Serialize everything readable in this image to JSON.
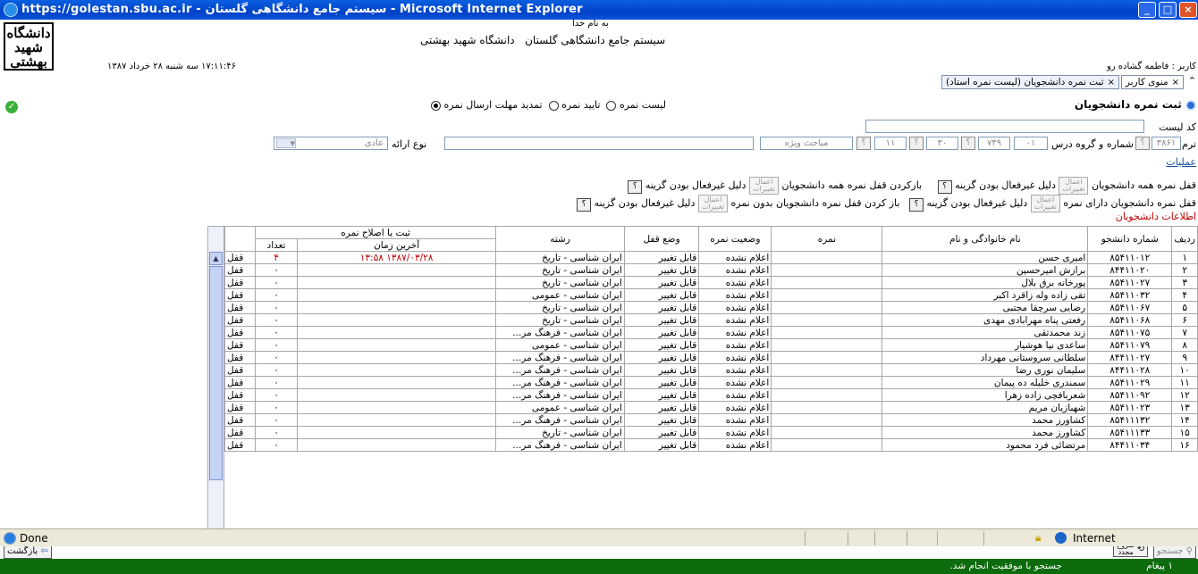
{
  "window": {
    "title": "https://golestan.sbu.ac.ir - سیستم جامع دانشگاهی گلستان - Microsoft Internet Explorer",
    "minimize": "_",
    "maximize": "□",
    "close": "×"
  },
  "header": {
    "basmala": "به نام خدا",
    "system_name": "سیستم جامع دانشگاهی گلستان",
    "university": "دانشگاه شهید بهشتی",
    "datetime": "۱۷:۱۱:۴۶ سه شنبه ۲۸ خرداد ۱۳۸۷",
    "user": "کاربر : فاطمه گشاده رو",
    "logo_lines": [
      "دانشگاه",
      "شهید",
      "بهشتی"
    ]
  },
  "tabs": [
    {
      "label": "منوی کاربر"
    },
    {
      "label": "ثبت نمره دانشجویان (لیست نمره استاد)"
    }
  ],
  "form": {
    "title": "ثبت نمره دانشجویان",
    "list_code_label": "کد لیست",
    "term_label": "ترم",
    "term_value": "۳۸۶۱",
    "course_label": "شماره و گروه درس",
    "course_values": [
      "۰۱",
      "۷۴۹",
      "۳۰",
      "۱۱"
    ],
    "special_topics_placeholder": "مباحث ویژه",
    "presentation_label": "نوع ارائه",
    "presentation_value": "عادی",
    "operations_link": "عملیات",
    "radios": [
      {
        "label": "لیست نمره",
        "selected": false
      },
      {
        "label": "تایید نمره",
        "selected": false
      },
      {
        "label": "تمدید مهلت ارسال نمره",
        "selected": true
      }
    ]
  },
  "actions": {
    "row1": [
      {
        "label": "قفل نمره همه دانشجویان",
        "reason": "دلیل غیرفعال بودن گزینه"
      },
      {
        "label": "بازکردن قفل نمره همه دانشجویان",
        "reason": "دلیل غیرفعال بودن گزینه"
      }
    ],
    "row2": [
      {
        "label": "قفل نمره دانشجویان دارای نمره",
        "reason": "دلیل غیرفعال بودن گزینه"
      },
      {
        "label": "باز کردن قفل نمره دانشجویان بدون نمره",
        "reason": "دلیل غیرفعال بودن گزینه"
      }
    ],
    "apply_label_top": "اعمال",
    "apply_label_bottom": "تغییرات",
    "help": "؟"
  },
  "students_section": "اطلاعات دانشجویان",
  "table": {
    "headers": {
      "row": "ردیف",
      "student_no": "شماره دانشجو",
      "name": "نام خانوادگی و نام",
      "grade": "نمره",
      "grade_status": "وضعیت نمره",
      "lock_status": "وضع قفل",
      "field": "رشته",
      "record_group": "ثبت یا اصلاح نمره",
      "last_time": "آخرین زمان",
      "count": "تعداد"
    },
    "rows": [
      {
        "n": "۱",
        "id": "۸۵۴۱۱۰۱۲",
        "name": "امیری حسن",
        "grade": "",
        "gs": "اعلام نشده",
        "ls": "قابل تغییر",
        "field": "ایران شناسی - تاریخ",
        "time": "۱۳۸۷/۰۳/۲۸ ۱۳:۵۸",
        "count": "۴",
        "lock": "قفل"
      },
      {
        "n": "۲",
        "id": "۸۴۴۱۱۰۲۰",
        "name": "برازش امیرحسین",
        "grade": "",
        "gs": "اعلام نشده",
        "ls": "قابل تغییر",
        "field": "ایران شناسی - تاریخ",
        "time": "",
        "count": "۰",
        "lock": "قفل"
      },
      {
        "n": "۳",
        "id": "۸۵۴۱۱۰۲۷",
        "name": "پورخانه برق بلال",
        "grade": "",
        "gs": "اعلام نشده",
        "ls": "قابل تغییر",
        "field": "ایران شناسی - تاریخ",
        "time": "",
        "count": "۰",
        "lock": "قفل"
      },
      {
        "n": "۴",
        "id": "۸۵۴۱۱۰۳۲",
        "name": "تقی زاده وله زاقرد اکبر",
        "grade": "",
        "gs": "اعلام نشده",
        "ls": "قابل تغییر",
        "field": "ایران شناسی - عمومی",
        "time": "",
        "count": "۰",
        "lock": "قفل"
      },
      {
        "n": "۵",
        "id": "۸۵۴۱۱۰۶۷",
        "name": "رضایی سرچقا مجتبی",
        "grade": "",
        "gs": "اعلام نشده",
        "ls": "قابل تغییر",
        "field": "ایران شناسی - تاریخ",
        "time": "",
        "count": "۰",
        "lock": "قفل"
      },
      {
        "n": "۶",
        "id": "۸۵۴۱۱۰۶۸",
        "name": "رفعتی پناه مهرابادی مهدی",
        "grade": "",
        "gs": "اعلام نشده",
        "ls": "قابل تغییر",
        "field": "ایران شناسی - تاریخ",
        "time": "",
        "count": "۰",
        "lock": "قفل"
      },
      {
        "n": "۷",
        "id": "۸۵۴۱۱۰۷۵",
        "name": "زند محمدتقی",
        "grade": "",
        "gs": "اعلام نشده",
        "ls": "قابل تغییر",
        "field": "ایران شناسی - فرهنگ مر...",
        "time": "",
        "count": "۰",
        "lock": "قفل"
      },
      {
        "n": "۸",
        "id": "۸۵۴۱۱۰۷۹",
        "name": "ساعدی نیا هوشیار",
        "grade": "",
        "gs": "اعلام نشده",
        "ls": "قابل تغییر",
        "field": "ایران شناسی - عمومی",
        "time": "",
        "count": "۰",
        "lock": "قفل"
      },
      {
        "n": "۹",
        "id": "۸۴۴۱۱۰۲۷",
        "name": "سلطانی سروستانی مهرداد",
        "grade": "",
        "gs": "اعلام نشده",
        "ls": "قابل تغییر",
        "field": "ایران شناسی - فرهنگ مر...",
        "time": "",
        "count": "۰",
        "lock": "قفل"
      },
      {
        "n": "۱۰",
        "id": "۸۴۴۱۱۰۲۸",
        "name": "سلیمان نوری رضا",
        "grade": "",
        "gs": "اعلام نشده",
        "ls": "قابل تغییر",
        "field": "ایران شناسی - فرهنگ مر...",
        "time": "",
        "count": "۰",
        "lock": "قفل"
      },
      {
        "n": "۱۱",
        "id": "۸۵۴۱۱۰۲۹",
        "name": "سمندری خلیله ده پیمان",
        "grade": "",
        "gs": "اعلام نشده",
        "ls": "قابل تغییر",
        "field": "ایران شناسی - فرهنگ مر...",
        "time": "",
        "count": "۰",
        "lock": "قفل"
      },
      {
        "n": "۱۲",
        "id": "۸۵۴۱۱۰۹۲",
        "name": "شعربافچی زاده زهرا",
        "grade": "",
        "gs": "اعلام نشده",
        "ls": "قابل تغییر",
        "field": "ایران شناسی - فرهنگ مر...",
        "time": "",
        "count": "۰",
        "lock": "قفل"
      },
      {
        "n": "۱۳",
        "id": "۸۵۴۱۱۰۲۳",
        "name": "شهبازیان مریم",
        "grade": "",
        "gs": "اعلام نشده",
        "ls": "قابل تغییر",
        "field": "ایران شناسی - عمومی",
        "time": "",
        "count": "۰",
        "lock": "قفل"
      },
      {
        "n": "۱۴",
        "id": "۸۵۴۱۱۱۳۲",
        "name": "کشاورز محمد",
        "grade": "",
        "gs": "اعلام نشده",
        "ls": "قابل تغییر",
        "field": "ایران شناسی - فرهنگ مر...",
        "time": "",
        "count": "۰",
        "lock": "قفل"
      },
      {
        "n": "۱۵",
        "id": "۸۵۴۱۱۱۳۳",
        "name": "کشاورز محمد",
        "grade": "",
        "gs": "اعلام نشده",
        "ls": "قابل تغییر",
        "field": "ایران شناسی - تاریخ",
        "time": "",
        "count": "۰",
        "lock": "قفل"
      },
      {
        "n": "۱۶",
        "id": "۸۴۴۱۱۰۳۴",
        "name": "مرتضائی فرد محمود",
        "grade": "",
        "gs": "اعلام نشده",
        "ls": "قابل تغییر",
        "field": "ایران شناسی - فرهنگ مر...",
        "time": "",
        "count": "۰",
        "lock": "قفل"
      }
    ]
  },
  "bottom": {
    "back": "بازگشت",
    "search": "جستجو",
    "start_top": "شروع",
    "start_bottom": "مجدد"
  },
  "status": {
    "messages_count": "۱ پیغام",
    "message": "جستجو با موفقیت انجام شد."
  },
  "ie_status": {
    "done": "Done",
    "zone": "Internet"
  }
}
